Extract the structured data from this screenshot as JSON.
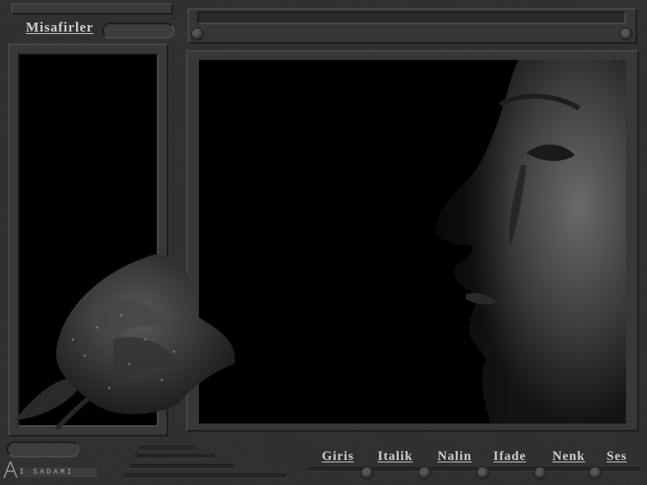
{
  "sidebar": {
    "title": "Misafirler"
  },
  "nav": {
    "items": [
      {
        "label": "Giris"
      },
      {
        "label": "Italik"
      },
      {
        "label": "Nalin"
      },
      {
        "label": "Ifade"
      },
      {
        "label": "Nenk"
      },
      {
        "label": "Ses"
      }
    ]
  },
  "logo": {
    "text": "I SADAMI"
  },
  "colors": {
    "background": "#2f2f2f",
    "panel_black": "#000000",
    "text": "#cfcfcf"
  },
  "images": {
    "main": "woman-profile-photo",
    "decoration": "rose-with-water-drops"
  }
}
